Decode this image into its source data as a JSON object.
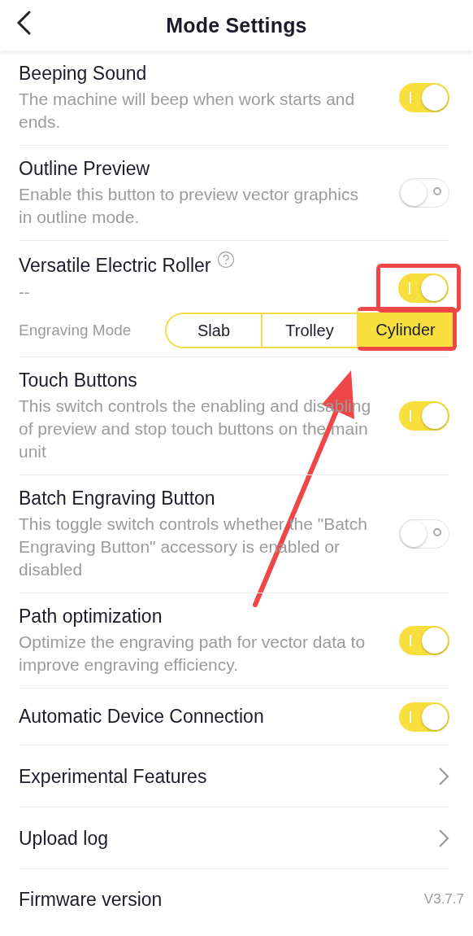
{
  "header": {
    "title": "Mode Settings"
  },
  "settings": [
    {
      "kind": "toggle",
      "title": "Beeping Sound",
      "description": "The machine will beep when work starts and ends.",
      "on": true,
      "highlighted": false
    },
    {
      "kind": "toggle",
      "title": "Outline Preview",
      "description": "Enable this button to preview vector graphics in outline mode.",
      "on": false,
      "highlighted": false
    },
    {
      "kind": "mode",
      "title": "Versatile Electric Roller",
      "subtitle": "--",
      "on": true,
      "highlighted": true,
      "mode_label": "Engraving Mode",
      "modes": [
        {
          "label": "Slab",
          "selected": false,
          "highlighted": false
        },
        {
          "label": "Trolley",
          "selected": false,
          "highlighted": false
        },
        {
          "label": "Cylinder",
          "selected": true,
          "highlighted": true
        }
      ]
    },
    {
      "kind": "toggle",
      "title": "Touch Buttons",
      "description": "This switch controls the enabling and disabling of preview and stop touch buttons on the main unit",
      "on": true,
      "highlighted": false
    },
    {
      "kind": "toggle",
      "title": "Batch Engraving Button",
      "description": "This toggle switch controls whether the \"Batch Engraving Button\" accessory is enabled or disabled",
      "on": false,
      "highlighted": false
    },
    {
      "kind": "toggle",
      "title": "Path optimization",
      "description": "Optimize the engraving path for vector data to improve engraving efficiency.",
      "on": true,
      "highlighted": false
    },
    {
      "kind": "toggle",
      "title": "Automatic Device Connection",
      "on": true,
      "highlighted": false
    },
    {
      "kind": "link",
      "title": "Experimental Features"
    },
    {
      "kind": "link",
      "title": "Upload log"
    },
    {
      "kind": "value",
      "title": "Firmware version",
      "value": "V3.7.7"
    }
  ]
}
